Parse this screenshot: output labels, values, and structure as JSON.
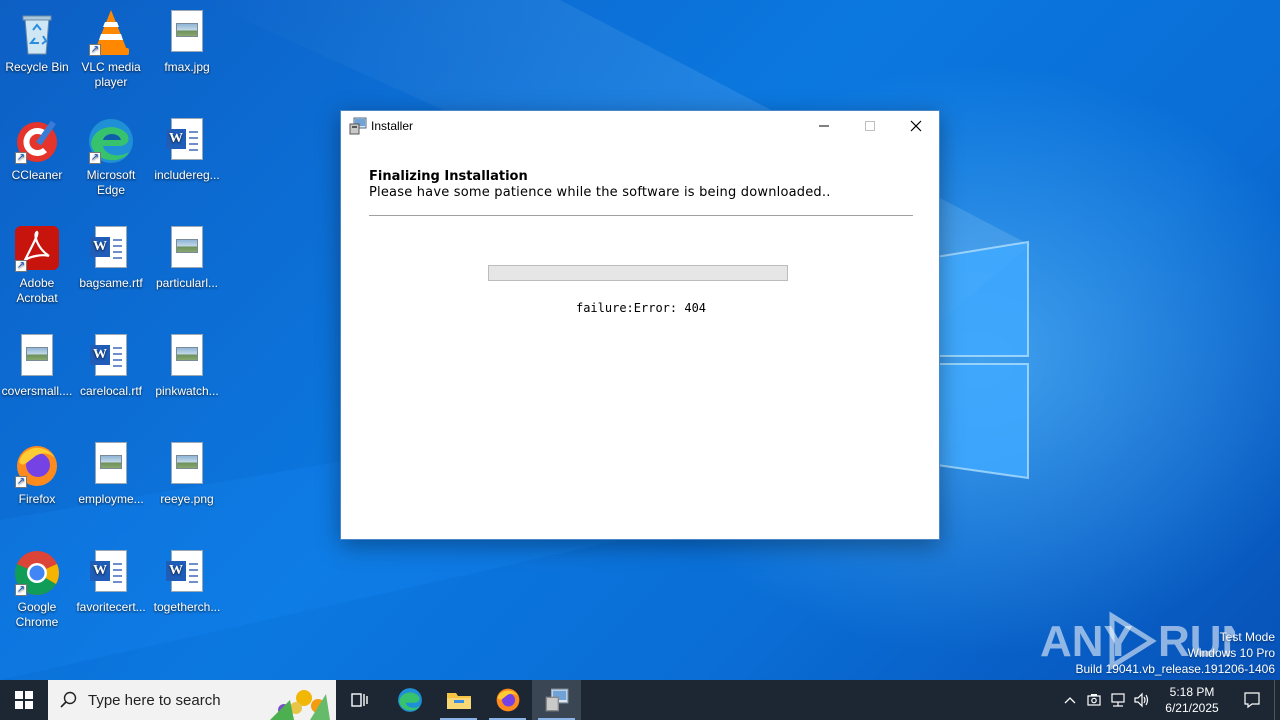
{
  "desktop": {
    "icons": [
      {
        "label": "Recycle Bin"
      },
      {
        "label": "VLC media player"
      },
      {
        "label": "fmax.jpg"
      },
      {
        "label": "CCleaner"
      },
      {
        "label": "Microsoft Edge"
      },
      {
        "label": "includereg..."
      },
      {
        "label": "Adobe Acrobat"
      },
      {
        "label": "bagsame.rtf"
      },
      {
        "label": "particularl..."
      },
      {
        "label": "coversmall...."
      },
      {
        "label": "carelocal.rtf"
      },
      {
        "label": "pinkwatch..."
      },
      {
        "label": "Firefox"
      },
      {
        "label": "employme..."
      },
      {
        "label": "reeye.png"
      },
      {
        "label": "Google Chrome"
      },
      {
        "label": "favoritecert..."
      },
      {
        "label": "togetherch..."
      }
    ]
  },
  "window": {
    "title": "Installer",
    "header_title": "Finalizing Installation",
    "header_subtitle": "Please have some patience while the software is being downloaded..",
    "progress": 0,
    "status": "failure:Error: 404"
  },
  "watermark": {
    "brand": "ANY RUN",
    "line1": "Test Mode",
    "line2": "Windows 10 Pro",
    "line3": "Build 19041.vb_release.191206-1406"
  },
  "taskbar": {
    "search_placeholder": "Type here to search",
    "time": "5:18 PM",
    "date": "6/21/2025"
  },
  "colors": {
    "desktop_blue": "#0b78e0",
    "taskbar": "#1c2733",
    "progress_fill": "#06b025"
  }
}
